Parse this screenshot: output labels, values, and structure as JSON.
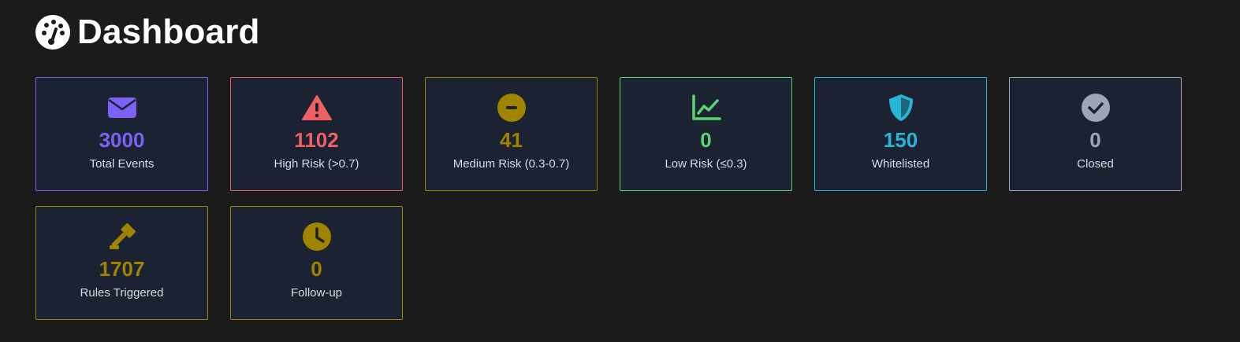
{
  "header": {
    "title": "Dashboard",
    "icon": "tachometer-icon"
  },
  "cards": [
    {
      "value": "3000",
      "label": "Total Events",
      "icon": "envelope-icon",
      "color": "#7b61f5",
      "border": "#7b61f5"
    },
    {
      "value": "1102",
      "label": "High Risk (>0.7)",
      "icon": "warning-triangle-icon",
      "color": "#f05f64",
      "border": "#f05f64"
    },
    {
      "value": "41",
      "label": "Medium Risk (0.3-0.7)",
      "icon": "minus-circle-icon",
      "color": "#a08400",
      "border": "#a08400"
    },
    {
      "value": "0",
      "label": "Low Risk (≤0.3)",
      "icon": "line-chart-icon",
      "color": "#5ad373",
      "border": "#5ad373"
    },
    {
      "value": "150",
      "label": "Whitelisted",
      "icon": "shield-icon",
      "color": "#27b6d6",
      "border": "#27b6d6"
    },
    {
      "value": "0",
      "label": "Closed",
      "icon": "check-circle-icon",
      "color": "#9da6b8",
      "border": "#9da6b8"
    },
    {
      "value": "1707",
      "label": "Rules Triggered",
      "icon": "gavel-icon",
      "color": "#a08400",
      "border": "#a08400"
    },
    {
      "value": "0",
      "label": "Follow-up",
      "icon": "clock-icon",
      "color": "#a08400",
      "border": "#a08400"
    }
  ]
}
